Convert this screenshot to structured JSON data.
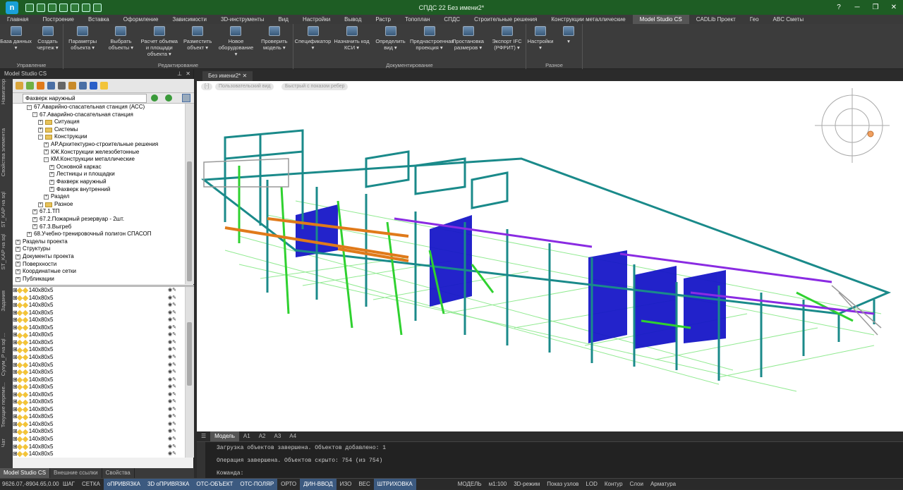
{
  "window": {
    "title": "СПДС 22 Без имени2*"
  },
  "menu_tabs": [
    "Главная",
    "Построение",
    "Вставка",
    "Оформление",
    "Зависимости",
    "3D-инструменты",
    "Вид",
    "Настройки",
    "Вывод",
    "Растр",
    "Топоплан",
    "СПДС",
    "Строительные решения",
    "Конструкции металлические",
    "Model Studio CS",
    "CADLib Проект",
    "Гео",
    "ABC Сметы"
  ],
  "active_tab": "Model Studio CS",
  "ribbon": {
    "groups": [
      {
        "label": "Управление",
        "buttons": [
          "База данных ▾",
          "Создать чертеж ▾"
        ]
      },
      {
        "label": "Редактирование",
        "buttons": [
          "Параметры объекта ▾",
          "Выбрать объекты ▾",
          "Расчет объема и площади объекта ▾",
          "Разместить объект ▾",
          "Новое оборудование ▾",
          "Проверить модель ▾"
        ]
      },
      {
        "label": "Документирование",
        "buttons": [
          "Спецификатор ▾",
          "Назначить код КСИ ▾",
          "Определить вид ▾",
          "Преднастроенная проекция ▾",
          "Простановка размеров ▾",
          "Экспорт IFC (РФРИТ) ▾"
        ]
      },
      {
        "label": "Разное",
        "buttons": [
          "Настройки ▾",
          "▾"
        ]
      }
    ]
  },
  "left_panel": {
    "title": "Model Studio CS",
    "search_value": "Фахверк наружный",
    "vertical_tabs": [
      "Навигатор",
      "Свойства элемента",
      "ST_KAP на sql",
      "ST_KAP на sql",
      "Задания",
      "Сухум_P на sql ...",
      "Текущие переме...",
      "Чат"
    ],
    "tree": [
      {
        "level": 2,
        "text": "67.Аварийно-спасательная станция (АСС)",
        "exp": "−"
      },
      {
        "level": 3,
        "text": "67.Аварийно-спасательная станция",
        "exp": "−"
      },
      {
        "level": 4,
        "text": "Ситуация",
        "exp": "+",
        "folder": true
      },
      {
        "level": 4,
        "text": "Системы",
        "exp": "+",
        "folder": true
      },
      {
        "level": 4,
        "text": "Конструкции",
        "exp": "−",
        "folder": true
      },
      {
        "level": 5,
        "text": "АР.Архитектурно-строительные решения",
        "exp": "+"
      },
      {
        "level": 5,
        "text": "КЖ.Конструкции железобетонные",
        "exp": "+"
      },
      {
        "level": 5,
        "text": "КМ.Конструкции металлические",
        "exp": "−"
      },
      {
        "level": 6,
        "text": "Основной каркас",
        "exp": "+"
      },
      {
        "level": 6,
        "text": "Лестницы и площадки",
        "exp": "+"
      },
      {
        "level": 6,
        "text": "Фахверк наружный",
        "exp": "+"
      },
      {
        "level": 6,
        "text": "Фахверк внутренний",
        "exp": "+"
      },
      {
        "level": 5,
        "text": "Раздел",
        "exp": "+"
      },
      {
        "level": 4,
        "text": "Разное",
        "exp": "+",
        "folder": true
      },
      {
        "level": 3,
        "text": "67.1.ТП",
        "exp": "+"
      },
      {
        "level": 3,
        "text": "67.2.Пожарный резервуар - 2шт.",
        "exp": "+"
      },
      {
        "level": 3,
        "text": "67.3.Выгреб",
        "exp": "+"
      },
      {
        "level": 2,
        "text": "68.Учебно-тренировочный полигон СПАСОП",
        "exp": "+"
      },
      {
        "level": 0,
        "text": "Разделы проекта",
        "exp": "+"
      },
      {
        "level": 0,
        "text": "Структуры",
        "exp": "+"
      },
      {
        "level": 0,
        "text": "Документы проекта",
        "exp": "+"
      },
      {
        "level": 0,
        "text": "Поверхности",
        "exp": "+"
      },
      {
        "level": 0,
        "text": "Координатные сетки",
        "exp": "+"
      },
      {
        "level": 0,
        "text": "Публикации",
        "exp": "+"
      }
    ],
    "list_item": "140x80x5",
    "list_count": 23,
    "bottom_tabs": [
      "Model Studio CS",
      "Внешние ссылки",
      "Свойства"
    ]
  },
  "document_tab": "Без имени2*",
  "viewport_labels": [
    "[-]",
    "Пользовательский вид",
    "Быстрый с показом ребер"
  ],
  "model_tabs": [
    "Модель",
    "A1",
    "A2",
    "A3",
    "A4"
  ],
  "command_lines": [
    "Загрузка объектов завершена. Объектов добавлено: 1",
    "Операция завершена. Объектов скрыто: 754 (из 754)",
    "Команда:"
  ],
  "status_bar": {
    "coords": "9626.07,-8904.65,0.00",
    "toggles": [
      {
        "label": "ШАГ",
        "on": false
      },
      {
        "label": "СЕТКА",
        "on": false
      },
      {
        "label": "оПРИВЯЗКА",
        "on": true
      },
      {
        "label": "3D оПРИВЯЗКА",
        "on": true
      },
      {
        "label": "ОТС-ОБЪЕКТ",
        "on": true
      },
      {
        "label": "ОТС-ПОЛЯР",
        "on": true
      },
      {
        "label": "ОРТО",
        "on": false
      },
      {
        "label": "ДИН-ВВОД",
        "on": true
      },
      {
        "label": "ИЗО",
        "on": false
      },
      {
        "label": "ВЕС",
        "on": false
      },
      {
        "label": "ШТРИХОВКА",
        "on": true
      }
    ],
    "model": "МОДЕЛЬ",
    "scale": "м1:100",
    "right": [
      "3D-режим",
      "Показ узлов",
      "LOD",
      "Контур",
      "Слои",
      "Арматура"
    ]
  },
  "colors": {
    "teal": "#1a8a8a",
    "green": "#2fd12f",
    "blue": "#1a1acc",
    "orange": "#e07a1a",
    "purple": "#8a2be2"
  }
}
